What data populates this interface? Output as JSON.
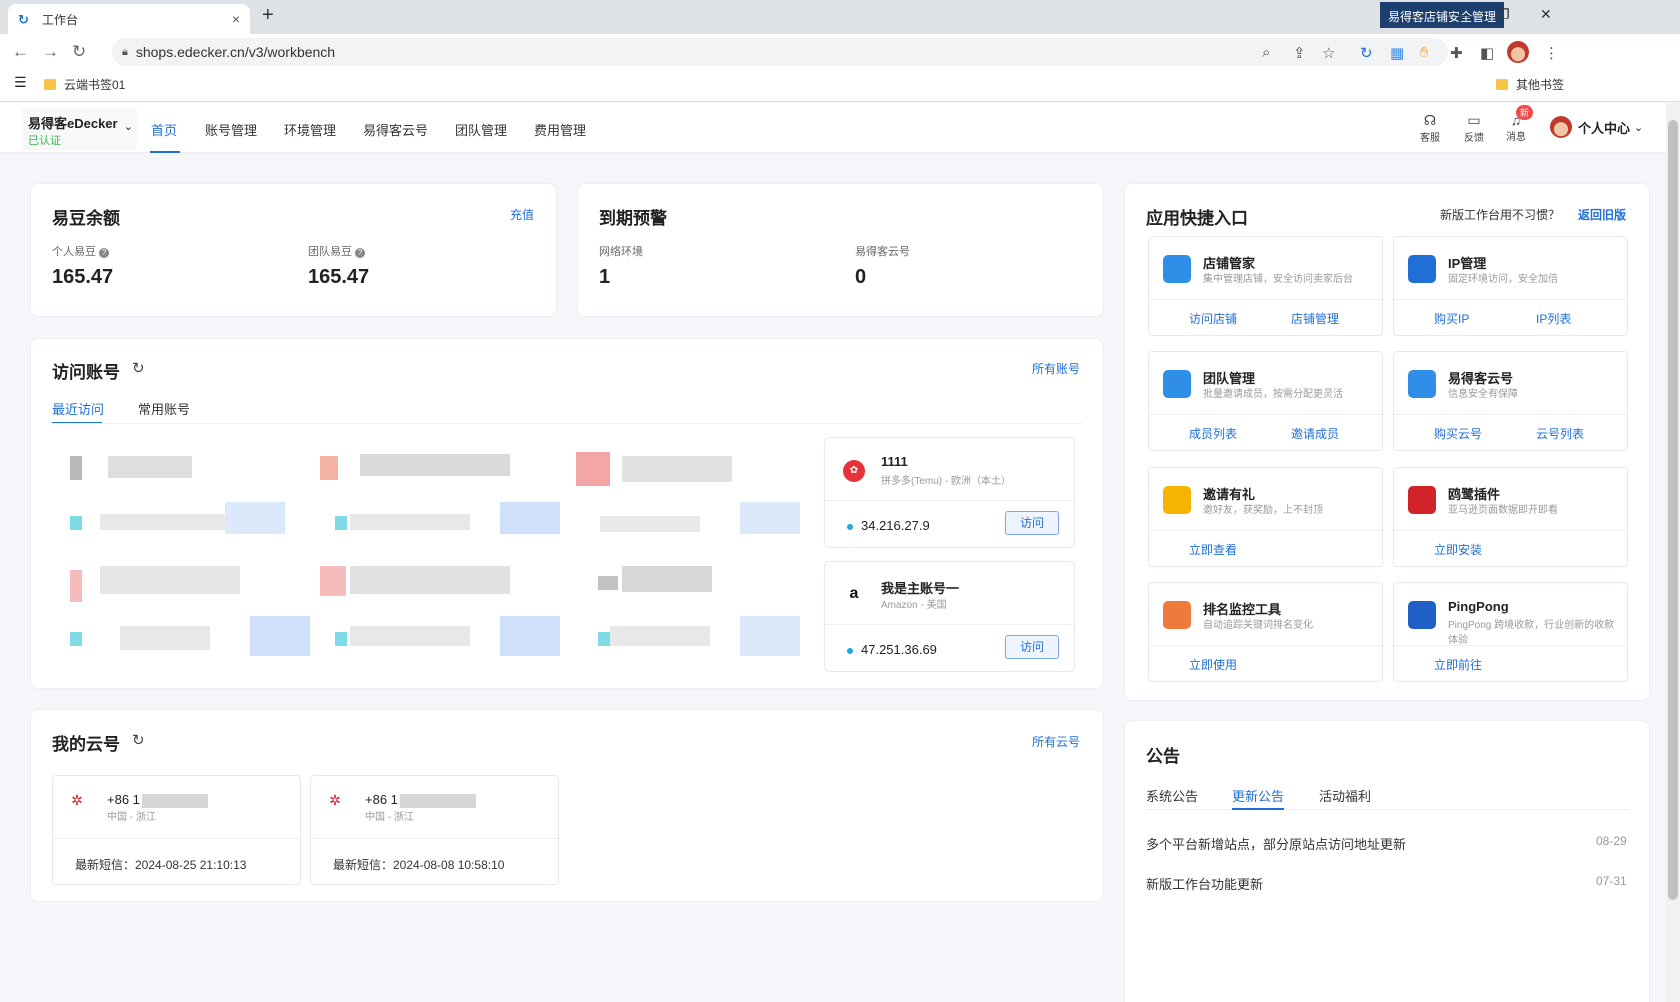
{
  "browser": {
    "tab_title": "工作台",
    "tab_close": "×",
    "new_tab": "+",
    "extension_badge": "易得客店铺安全管理",
    "url": "shops.edecker.cn/v3/workbench",
    "bookmark_1": "云端书签01",
    "bookmark_other": "其他书签",
    "win_min": "—",
    "win_max": "❐",
    "win_close": "✕"
  },
  "header": {
    "brand_name": "易得客eDecker",
    "brand_verified": "已认证",
    "nav": [
      "首页",
      "账号管理",
      "环境管理",
      "易得客云号",
      "团队管理",
      "费用管理"
    ],
    "service_label": "客服",
    "feedback_label": "反馈",
    "message_label": "消息",
    "new_badge": "新",
    "user_center": "个人中心"
  },
  "balance": {
    "title": "易豆余额",
    "recharge": "充值",
    "personal_label": "个人易豆",
    "personal_value": "165.47",
    "team_label": "团队易豆",
    "team_value": "165.47"
  },
  "expiry": {
    "title": "到期预警",
    "network_label": "网络环境",
    "network_value": "1",
    "cloud_label": "易得客云号",
    "cloud_value": "0"
  },
  "visit": {
    "title": "访问账号",
    "all_link": "所有账号",
    "tabs": [
      "最近访问",
      "常用账号"
    ],
    "accounts": [
      {
        "name": "1111",
        "platform": "拼多多(Temu) - 欧洲（本土）",
        "ip": "34.216.27.9",
        "button": "访问"
      },
      {
        "name": "我是主账号一",
        "platform": "Amazon - 美国",
        "ip": "47.251.36.69",
        "button": "访问"
      }
    ]
  },
  "cloud": {
    "title": "我的云号",
    "all_link": "所有云号",
    "items": [
      {
        "phone": "+86 1",
        "region": "中国 - 浙江",
        "sms": "最新短信：2024-08-25 21:10:13"
      },
      {
        "phone": "+86 1",
        "region": "中国 - 浙江",
        "sms": "最新短信：2024-08-08 10:58:10"
      }
    ]
  },
  "shortcuts": {
    "title": "应用快捷入口",
    "old_question": "新版工作台用不习惯？",
    "old_link": "返回旧版",
    "entries": [
      {
        "name": "店铺管家",
        "desc": "集中管理店铺，安全访问卖家后台",
        "actions": [
          "访问店铺",
          "店铺管理"
        ],
        "color": "#2f8fe8"
      },
      {
        "name": "IP管理",
        "desc": "固定环境访问，安全加倍",
        "actions": [
          "购买IP",
          "IP列表"
        ],
        "color": "#1f6fd6"
      },
      {
        "name": "团队管理",
        "desc": "批量邀请成员，按需分配更灵活",
        "actions": [
          "成员列表",
          "邀请成员"
        ],
        "color": "#2f8fe8"
      },
      {
        "name": "易得客云号",
        "desc": "信息安全有保障",
        "actions": [
          "购买云号",
          "云号列表"
        ],
        "color": "#2f8fe8"
      },
      {
        "name": "邀请有礼",
        "desc": "邀好友，获奖励，上不封顶",
        "actions": [
          "立即查看"
        ],
        "color": "#f5b400"
      },
      {
        "name": "鸥鹭插件",
        "desc": "亚马逊页面数据即开即看",
        "actions": [
          "立即安装"
        ],
        "color": "#d2232a"
      },
      {
        "name": "排名监控工具",
        "desc": "自动追踪关键词排名变化",
        "actions": [
          "立即使用"
        ],
        "color": "#f07a3c"
      },
      {
        "name": "PingPong",
        "desc": "PingPong 跨境收款，行业创新的收款体验",
        "actions": [
          "立即前往"
        ],
        "color": "#1f5fc7"
      }
    ]
  },
  "notice": {
    "title": "公告",
    "tabs": [
      "系统公告",
      "更新公告",
      "活动福利"
    ],
    "items": [
      {
        "text": "多个平台新增站点，部分原站点访问地址更新",
        "date": "08-29"
      },
      {
        "text": "新版工作台功能更新",
        "date": "07-31"
      }
    ]
  }
}
